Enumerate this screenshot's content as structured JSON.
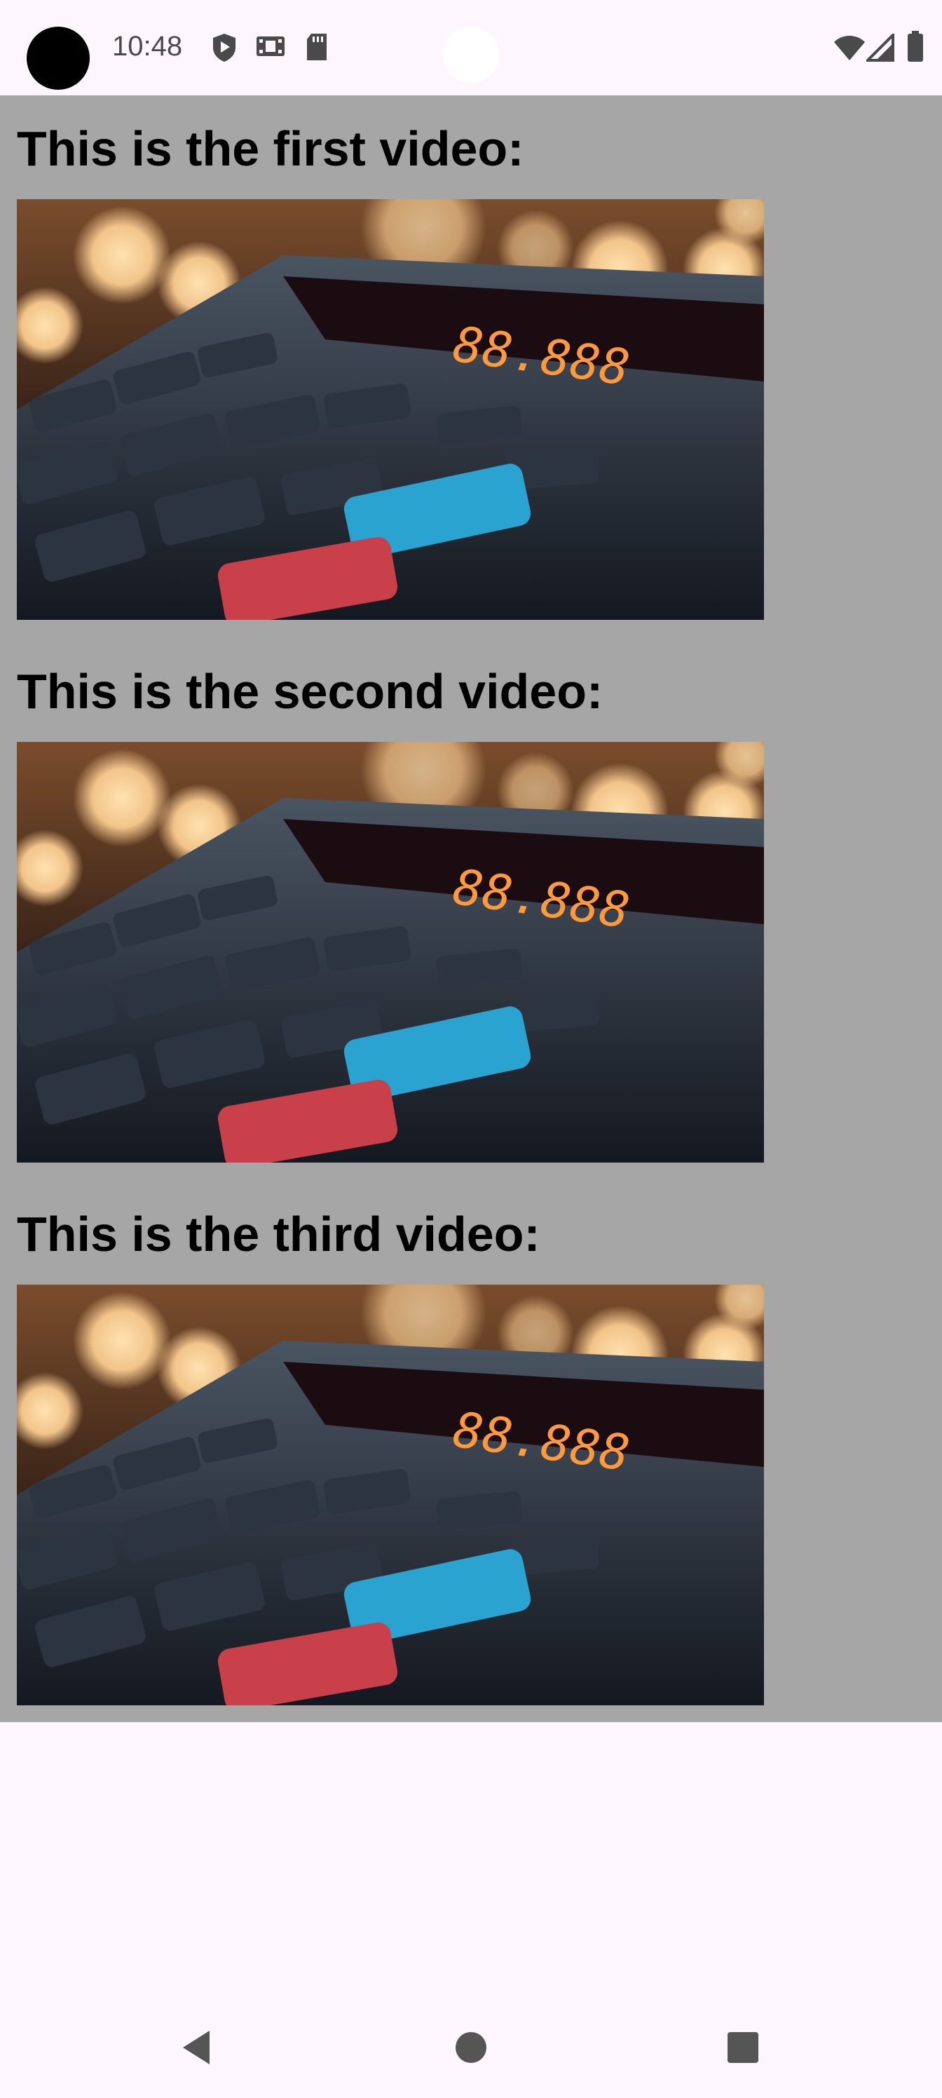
{
  "status_bar": {
    "time": "10:48",
    "left_icons": [
      "play-shield-icon",
      "film-icon",
      "sd-card-icon"
    ],
    "right_icons": [
      "wifi-icon",
      "cell-signal-icon",
      "battery-icon"
    ]
  },
  "videos": [
    {
      "heading": "This is the first video:",
      "poster_display": "88.888"
    },
    {
      "heading": "This is the second video:",
      "poster_display": "88.888"
    },
    {
      "heading": "This is the third video:",
      "poster_display": "88.888"
    }
  ],
  "nav_bar": {
    "icons": [
      "back-icon",
      "home-icon",
      "recents-icon"
    ]
  },
  "colors": {
    "system_bar_bg": "#fdf6fc",
    "content_bg": "#a6a6a6",
    "heading_text": "#000000"
  }
}
